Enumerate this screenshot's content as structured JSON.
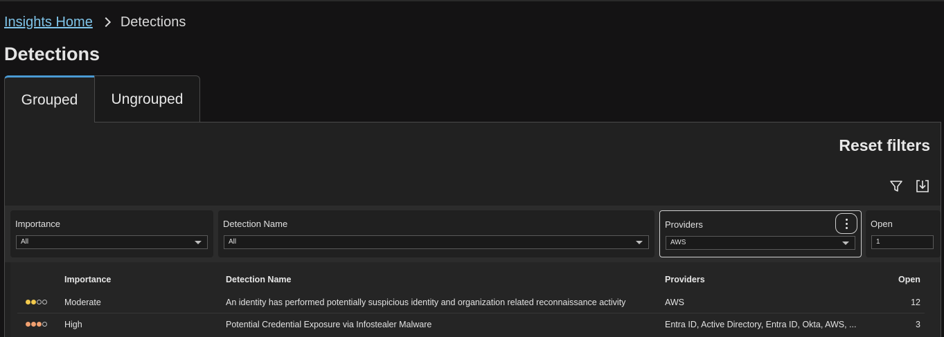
{
  "breadcrumb": {
    "home": "Insights Home",
    "current": "Detections"
  },
  "page": {
    "title": "Detections"
  },
  "tabs": [
    {
      "label": "Grouped",
      "active": true
    },
    {
      "label": "Ungrouped",
      "active": false
    }
  ],
  "toolbar": {
    "reset_filters": "Reset filters",
    "filter_icon": "funnel-icon",
    "export_icon": "export-download-icon"
  },
  "filters": {
    "importance": {
      "label": "Importance",
      "value": "All"
    },
    "detection_name": {
      "label": "Detection Name",
      "value": "All"
    },
    "providers": {
      "label": "Providers",
      "value": "AWS"
    },
    "open": {
      "label": "Open",
      "value": "1"
    }
  },
  "table": {
    "columns": {
      "importance": "Importance",
      "detection_name": "Detection Name",
      "providers": "Providers",
      "open": "Open"
    },
    "rows": [
      {
        "importance": "Moderate",
        "importance_level": 2,
        "importance_color": "#f2c94c",
        "detection_name": "An identity has performed potentially suspicious identity and organization related reconnaissance activity",
        "providers": "AWS",
        "open": "12"
      },
      {
        "importance": "High",
        "importance_level": 3,
        "importance_color": "#f0a070",
        "detection_name": "Potential Credential Exposure via Infostealer Malware",
        "providers": "Entra ID, Active Directory, Entra ID, Okta, AWS, ...",
        "open": "3"
      }
    ]
  },
  "colors": {
    "accent": "#4a9ad4",
    "link": "#7fc4e9"
  }
}
